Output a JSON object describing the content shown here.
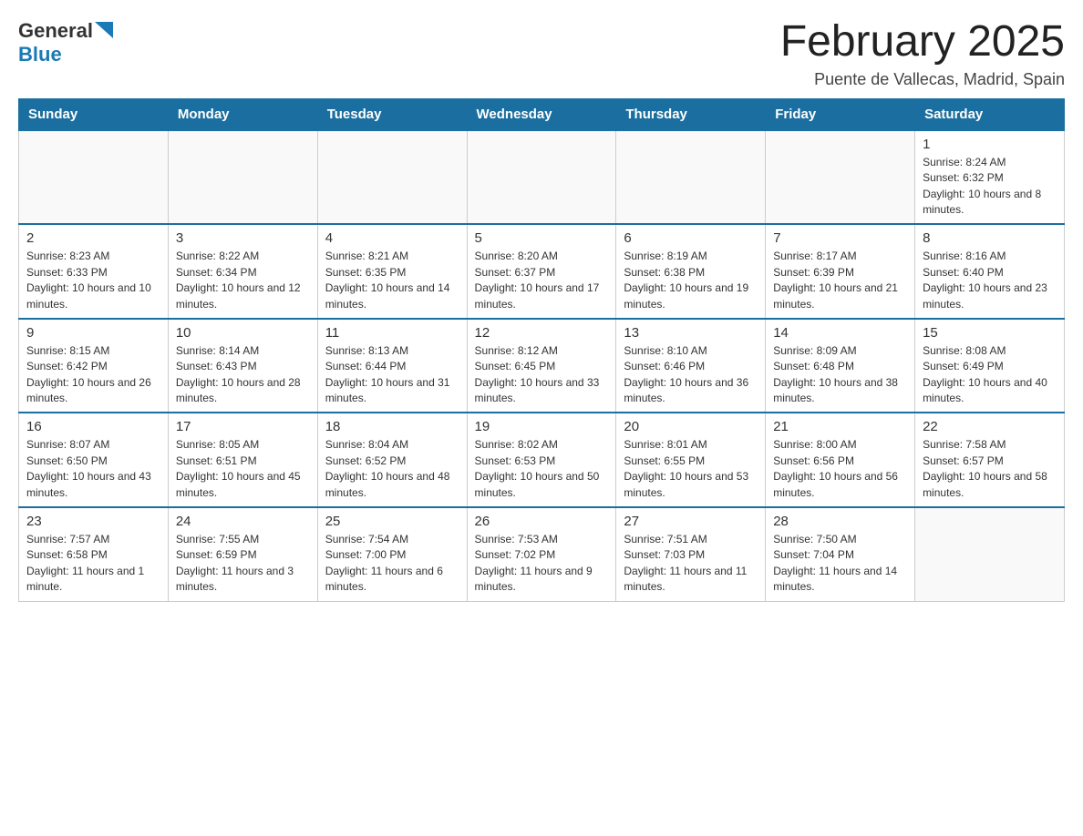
{
  "header": {
    "logo": {
      "general": "General",
      "blue": "Blue"
    },
    "title": "February 2025",
    "location": "Puente de Vallecas, Madrid, Spain"
  },
  "calendar": {
    "days_of_week": [
      "Sunday",
      "Monday",
      "Tuesday",
      "Wednesday",
      "Thursday",
      "Friday",
      "Saturday"
    ],
    "weeks": [
      [
        {
          "day": "",
          "info": ""
        },
        {
          "day": "",
          "info": ""
        },
        {
          "day": "",
          "info": ""
        },
        {
          "day": "",
          "info": ""
        },
        {
          "day": "",
          "info": ""
        },
        {
          "day": "",
          "info": ""
        },
        {
          "day": "1",
          "info": "Sunrise: 8:24 AM\nSunset: 6:32 PM\nDaylight: 10 hours and 8 minutes."
        }
      ],
      [
        {
          "day": "2",
          "info": "Sunrise: 8:23 AM\nSunset: 6:33 PM\nDaylight: 10 hours and 10 minutes."
        },
        {
          "day": "3",
          "info": "Sunrise: 8:22 AM\nSunset: 6:34 PM\nDaylight: 10 hours and 12 minutes."
        },
        {
          "day": "4",
          "info": "Sunrise: 8:21 AM\nSunset: 6:35 PM\nDaylight: 10 hours and 14 minutes."
        },
        {
          "day": "5",
          "info": "Sunrise: 8:20 AM\nSunset: 6:37 PM\nDaylight: 10 hours and 17 minutes."
        },
        {
          "day": "6",
          "info": "Sunrise: 8:19 AM\nSunset: 6:38 PM\nDaylight: 10 hours and 19 minutes."
        },
        {
          "day": "7",
          "info": "Sunrise: 8:17 AM\nSunset: 6:39 PM\nDaylight: 10 hours and 21 minutes."
        },
        {
          "day": "8",
          "info": "Sunrise: 8:16 AM\nSunset: 6:40 PM\nDaylight: 10 hours and 23 minutes."
        }
      ],
      [
        {
          "day": "9",
          "info": "Sunrise: 8:15 AM\nSunset: 6:42 PM\nDaylight: 10 hours and 26 minutes."
        },
        {
          "day": "10",
          "info": "Sunrise: 8:14 AM\nSunset: 6:43 PM\nDaylight: 10 hours and 28 minutes."
        },
        {
          "day": "11",
          "info": "Sunrise: 8:13 AM\nSunset: 6:44 PM\nDaylight: 10 hours and 31 minutes."
        },
        {
          "day": "12",
          "info": "Sunrise: 8:12 AM\nSunset: 6:45 PM\nDaylight: 10 hours and 33 minutes."
        },
        {
          "day": "13",
          "info": "Sunrise: 8:10 AM\nSunset: 6:46 PM\nDaylight: 10 hours and 36 minutes."
        },
        {
          "day": "14",
          "info": "Sunrise: 8:09 AM\nSunset: 6:48 PM\nDaylight: 10 hours and 38 minutes."
        },
        {
          "day": "15",
          "info": "Sunrise: 8:08 AM\nSunset: 6:49 PM\nDaylight: 10 hours and 40 minutes."
        }
      ],
      [
        {
          "day": "16",
          "info": "Sunrise: 8:07 AM\nSunset: 6:50 PM\nDaylight: 10 hours and 43 minutes."
        },
        {
          "day": "17",
          "info": "Sunrise: 8:05 AM\nSunset: 6:51 PM\nDaylight: 10 hours and 45 minutes."
        },
        {
          "day": "18",
          "info": "Sunrise: 8:04 AM\nSunset: 6:52 PM\nDaylight: 10 hours and 48 minutes."
        },
        {
          "day": "19",
          "info": "Sunrise: 8:02 AM\nSunset: 6:53 PM\nDaylight: 10 hours and 50 minutes."
        },
        {
          "day": "20",
          "info": "Sunrise: 8:01 AM\nSunset: 6:55 PM\nDaylight: 10 hours and 53 minutes."
        },
        {
          "day": "21",
          "info": "Sunrise: 8:00 AM\nSunset: 6:56 PM\nDaylight: 10 hours and 56 minutes."
        },
        {
          "day": "22",
          "info": "Sunrise: 7:58 AM\nSunset: 6:57 PM\nDaylight: 10 hours and 58 minutes."
        }
      ],
      [
        {
          "day": "23",
          "info": "Sunrise: 7:57 AM\nSunset: 6:58 PM\nDaylight: 11 hours and 1 minute."
        },
        {
          "day": "24",
          "info": "Sunrise: 7:55 AM\nSunset: 6:59 PM\nDaylight: 11 hours and 3 minutes."
        },
        {
          "day": "25",
          "info": "Sunrise: 7:54 AM\nSunset: 7:00 PM\nDaylight: 11 hours and 6 minutes."
        },
        {
          "day": "26",
          "info": "Sunrise: 7:53 AM\nSunset: 7:02 PM\nDaylight: 11 hours and 9 minutes."
        },
        {
          "day": "27",
          "info": "Sunrise: 7:51 AM\nSunset: 7:03 PM\nDaylight: 11 hours and 11 minutes."
        },
        {
          "day": "28",
          "info": "Sunrise: 7:50 AM\nSunset: 7:04 PM\nDaylight: 11 hours and 14 minutes."
        },
        {
          "day": "",
          "info": ""
        }
      ]
    ]
  }
}
